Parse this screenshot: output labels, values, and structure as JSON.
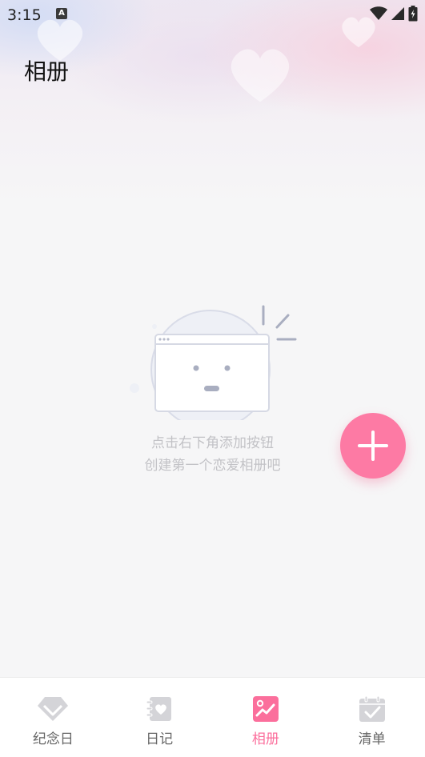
{
  "status_bar": {
    "time": "3:15",
    "notification_icon": "A"
  },
  "header": {
    "title": "相册"
  },
  "empty_state": {
    "line1": "点击右下角添加按钮",
    "line2": "创建第一个恋爱相册吧"
  },
  "fab": {
    "icon": "plus-icon"
  },
  "bottom_nav": {
    "items": [
      {
        "label": "纪念日",
        "icon": "diamond-icon"
      },
      {
        "label": "日记",
        "icon": "diary-heart-icon"
      },
      {
        "label": "相册",
        "icon": "album-icon"
      },
      {
        "label": "清单",
        "icon": "calendar-check-icon"
      }
    ],
    "active_index": 2
  },
  "colors": {
    "accent": "#fd7aa4",
    "inactive_icon": "#d4d4d8",
    "inactive_text": "#666666"
  }
}
